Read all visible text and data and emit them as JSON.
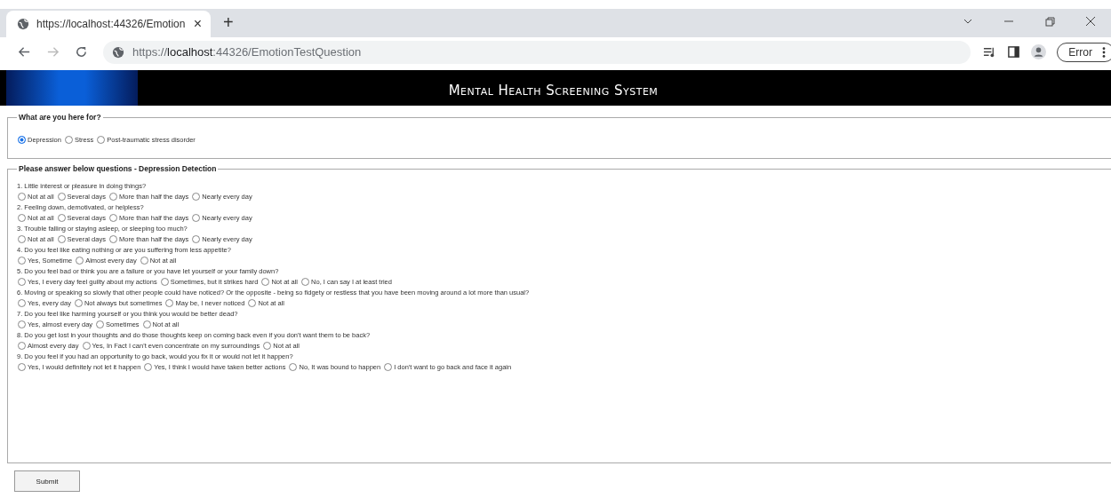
{
  "browser": {
    "tab_title": "https://localhost:44326/Emotion",
    "tab_close": "×",
    "new_tab": "+",
    "url": "https://**localhost**:44326/EmotionTestQuestion",
    "profile_button": "Error"
  },
  "header": {
    "title": "Mental Health Screening System"
  },
  "purpose": {
    "legend": "What are you here for?",
    "options": [
      {
        "label": "Depression",
        "selected": true
      },
      {
        "label": "Stress",
        "selected": false
      },
      {
        "label": "Post-traumatic stress disorder",
        "selected": false
      }
    ]
  },
  "questionnaire": {
    "legend": "Please answer below questions - Depression Detection",
    "questions": [
      {
        "text": "1. Little interest or pleasure in doing things?",
        "options": [
          {
            "label": "Not at all",
            "selected": false
          },
          {
            "label": "Several days",
            "selected": false
          },
          {
            "label": "More than half the days",
            "selected": false
          },
          {
            "label": "Nearly every day",
            "selected": false
          }
        ]
      },
      {
        "text": "2. Feeling down, demotivated, or helpless?",
        "options": [
          {
            "label": "Not at all",
            "selected": false
          },
          {
            "label": "Several days",
            "selected": false
          },
          {
            "label": "More than half the days",
            "selected": false
          },
          {
            "label": "Nearly every day",
            "selected": false
          }
        ]
      },
      {
        "text": "3. Trouble falling or staying asleep, or sleeping too much?",
        "options": [
          {
            "label": "Not at all",
            "selected": false
          },
          {
            "label": "Several days",
            "selected": false
          },
          {
            "label": "More than half the days",
            "selected": false
          },
          {
            "label": "Nearly every day",
            "selected": false
          }
        ]
      },
      {
        "text": "4. Do you feel like eating nothing or are you suffering from less appetite?",
        "options": [
          {
            "label": "Yes, Sometime",
            "selected": false
          },
          {
            "label": "Almost every day",
            "selected": false
          },
          {
            "label": "Not at all",
            "selected": false
          }
        ]
      },
      {
        "text": "5. Do you feel bad or think you are a failure or you have let yourself or your family down?",
        "options": [
          {
            "label": "Yes, I every day feel guilty about my actions",
            "selected": false
          },
          {
            "label": "Sometimes, but it strikes hard",
            "selected": false
          },
          {
            "label": "Not at all",
            "selected": false
          },
          {
            "label": "No, I can say I at least tried",
            "selected": false
          }
        ]
      },
      {
        "text": "6. Moving or speaking so slowly that other people could have noticed? Or the opposite - being so fidgety or restless that you have been moving around a lot more than usual?",
        "options": [
          {
            "label": "Yes, every day",
            "selected": false
          },
          {
            "label": "Not always but sometimes",
            "selected": false
          },
          {
            "label": "May be, I never noticed",
            "selected": false
          },
          {
            "label": "Not at all",
            "selected": false
          }
        ]
      },
      {
        "text": "7. Do you feel like harming yourself or you think you would be better dead?",
        "options": [
          {
            "label": "Yes, almost every day",
            "selected": false
          },
          {
            "label": "Sometimes",
            "selected": false
          },
          {
            "label": "Not at all",
            "selected": false
          }
        ]
      },
      {
        "text": "8. Do you get lost in your thoughts and do those thoughts keep on coming back even if you don't want them to be back?",
        "options": [
          {
            "label": "Almost every day",
            "selected": false
          },
          {
            "label": "Yes, In Fact I can't even concentrate on my surroundings",
            "selected": false
          },
          {
            "label": "Not at all",
            "selected": false
          }
        ]
      },
      {
        "text": "9. Do you feel if you had an opportunity to go back, would you fix it or would not let it happen?",
        "options": [
          {
            "label": "Yes, I would definitely not let it happen",
            "selected": false
          },
          {
            "label": "Yes, I think I would have taken better actions",
            "selected": false
          },
          {
            "label": "No, It was bound to happen",
            "selected": false
          },
          {
            "label": "I don't want to go back and face it again",
            "selected": false
          }
        ]
      }
    ]
  },
  "submit_button": "Submit"
}
